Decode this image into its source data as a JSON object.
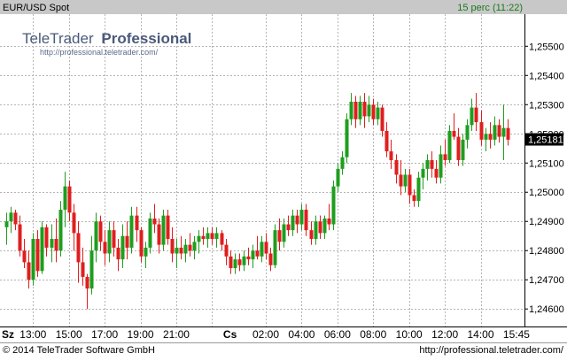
{
  "header": {
    "symbol": "EUR/USD Spot",
    "interval": "15 perc (11:22)"
  },
  "watermark": {
    "brand_light": "TeleTrader",
    "brand_bold": "Professional",
    "url": "http://professional.teletrader.com/"
  },
  "footer": {
    "copyright": "© 2014  TeleTrader Software GmbH",
    "url": "http://professional.teletrader.com/"
  },
  "colors": {
    "header_bg": "#c8c8c8",
    "plot_bg": "#ffffff",
    "grid": "#b4b4b4",
    "up": "#1e9e1e",
    "down": "#e01e1e",
    "last_price_bg": "#000000",
    "last_price_text": "#ffffff",
    "header_right_text": "#1a7a1a"
  },
  "chart_data": {
    "type": "candlestick",
    "y_axis": {
      "min": 1.2454,
      "max": 1.2561,
      "ticks": [
        "1,25500",
        "1,25400",
        "1,25300",
        "1,25200",
        "1,25100",
        "1,25000",
        "1,24900",
        "1,24800",
        "1,24700",
        "1,24600"
      ],
      "tick_values": [
        1.255,
        1.254,
        1.253,
        1.252,
        1.251,
        1.25,
        1.249,
        1.248,
        1.247,
        1.246
      ],
      "position": "right",
      "last_price_label": "1,25181",
      "last_price": 1.25181
    },
    "x_axis": {
      "labels": [
        "Sz",
        "13:00",
        "15:00",
        "17:00",
        "19:00",
        "21:00",
        "Cs",
        "02:00",
        "04:00",
        "06:00",
        "08:00",
        "10:00",
        "12:00",
        "14:00",
        "15:45"
      ],
      "label_slots": [
        0,
        6,
        14,
        22,
        30,
        38,
        50,
        58,
        66,
        74,
        82,
        90,
        98,
        106,
        114
      ],
      "grid_slots": [
        6,
        14,
        22,
        30,
        38,
        46,
        58,
        66,
        74,
        82,
        90,
        98,
        106
      ],
      "slot_count": 116
    },
    "grid": true,
    "candles": [
      {
        "o": 1.2488,
        "h": 1.2493,
        "l": 1.2482,
        "c": 1.249
      },
      {
        "o": 1.249,
        "h": 1.2495,
        "l": 1.2486,
        "c": 1.2493
      },
      {
        "o": 1.2493,
        "h": 1.2494,
        "l": 1.2487,
        "c": 1.2489
      },
      {
        "o": 1.2489,
        "h": 1.2492,
        "l": 1.2478,
        "c": 1.248
      },
      {
        "o": 1.248,
        "h": 1.2484,
        "l": 1.2474,
        "c": 1.2476
      },
      {
        "o": 1.2476,
        "h": 1.248,
        "l": 1.2467,
        "c": 1.247
      },
      {
        "o": 1.247,
        "h": 1.2486,
        "l": 1.2468,
        "c": 1.2484
      },
      {
        "o": 1.2484,
        "h": 1.2487,
        "l": 1.2471,
        "c": 1.2473
      },
      {
        "o": 1.2473,
        "h": 1.249,
        "l": 1.2472,
        "c": 1.2488
      },
      {
        "o": 1.2488,
        "h": 1.2489,
        "l": 1.2478,
        "c": 1.2481
      },
      {
        "o": 1.2481,
        "h": 1.2489,
        "l": 1.2476,
        "c": 1.2484
      },
      {
        "o": 1.2484,
        "h": 1.2491,
        "l": 1.2476,
        "c": 1.248
      },
      {
        "o": 1.248,
        "h": 1.2497,
        "l": 1.2478,
        "c": 1.2494
      },
      {
        "o": 1.2494,
        "h": 1.2507,
        "l": 1.2488,
        "c": 1.2502
      },
      {
        "o": 1.2502,
        "h": 1.2504,
        "l": 1.249,
        "c": 1.2493
      },
      {
        "o": 1.2493,
        "h": 1.2496,
        "l": 1.248,
        "c": 1.2486
      },
      {
        "o": 1.2486,
        "h": 1.249,
        "l": 1.2469,
        "c": 1.2476
      },
      {
        "o": 1.2476,
        "h": 1.2481,
        "l": 1.2468,
        "c": 1.2471
      },
      {
        "o": 1.2471,
        "h": 1.2472,
        "l": 1.246,
        "c": 1.2467
      },
      {
        "o": 1.2467,
        "h": 1.2485,
        "l": 1.2465,
        "c": 1.248
      },
      {
        "o": 1.248,
        "h": 1.2493,
        "l": 1.2476,
        "c": 1.249
      },
      {
        "o": 1.249,
        "h": 1.2492,
        "l": 1.248,
        "c": 1.2483
      },
      {
        "o": 1.2483,
        "h": 1.2487,
        "l": 1.2475,
        "c": 1.2479
      },
      {
        "o": 1.2479,
        "h": 1.249,
        "l": 1.2476,
        "c": 1.2487
      },
      {
        "o": 1.2487,
        "h": 1.249,
        "l": 1.2478,
        "c": 1.2481
      },
      {
        "o": 1.2481,
        "h": 1.2484,
        "l": 1.2473,
        "c": 1.2477
      },
      {
        "o": 1.2477,
        "h": 1.2489,
        "l": 1.2474,
        "c": 1.2485
      },
      {
        "o": 1.2485,
        "h": 1.249,
        "l": 1.2477,
        "c": 1.2481
      },
      {
        "o": 1.2481,
        "h": 1.2495,
        "l": 1.2479,
        "c": 1.2492
      },
      {
        "o": 1.2492,
        "h": 1.2495,
        "l": 1.2483,
        "c": 1.2487
      },
      {
        "o": 1.2487,
        "h": 1.2488,
        "l": 1.2476,
        "c": 1.2478
      },
      {
        "o": 1.2478,
        "h": 1.2483,
        "l": 1.2474,
        "c": 1.2481
      },
      {
        "o": 1.2481,
        "h": 1.2493,
        "l": 1.2479,
        "c": 1.2491
      },
      {
        "o": 1.2491,
        "h": 1.2496,
        "l": 1.2486,
        "c": 1.2489
      },
      {
        "o": 1.2489,
        "h": 1.2491,
        "l": 1.2479,
        "c": 1.2482
      },
      {
        "o": 1.2482,
        "h": 1.2494,
        "l": 1.248,
        "c": 1.2492
      },
      {
        "o": 1.2492,
        "h": 1.2494,
        "l": 1.2482,
        "c": 1.2484
      },
      {
        "o": 1.2484,
        "h": 1.2488,
        "l": 1.2476,
        "c": 1.2479
      },
      {
        "o": 1.2479,
        "h": 1.2484,
        "l": 1.2474,
        "c": 1.2481
      },
      {
        "o": 1.2481,
        "h": 1.2485,
        "l": 1.2477,
        "c": 1.2479
      },
      {
        "o": 1.2479,
        "h": 1.2484,
        "l": 1.2476,
        "c": 1.2482
      },
      {
        "o": 1.2482,
        "h": 1.2486,
        "l": 1.2478,
        "c": 1.248
      },
      {
        "o": 1.248,
        "h": 1.2485,
        "l": 1.2477,
        "c": 1.2483
      },
      {
        "o": 1.2483,
        "h": 1.2487,
        "l": 1.2479,
        "c": 1.2485
      },
      {
        "o": 1.2485,
        "h": 1.2488,
        "l": 1.2482,
        "c": 1.2484
      },
      {
        "o": 1.2484,
        "h": 1.2488,
        "l": 1.2481,
        "c": 1.2486
      },
      {
        "o": 1.2486,
        "h": 1.2488,
        "l": 1.2482,
        "c": 1.2484
      },
      {
        "o": 1.2484,
        "h": 1.2488,
        "l": 1.2481,
        "c": 1.2486
      },
      {
        "o": 1.2486,
        "h": 1.2487,
        "l": 1.248,
        "c": 1.2482
      },
      {
        "o": 1.2482,
        "h": 1.2484,
        "l": 1.2475,
        "c": 1.2478
      },
      {
        "o": 1.2478,
        "h": 1.248,
        "l": 1.2472,
        "c": 1.2474
      },
      {
        "o": 1.2474,
        "h": 1.2479,
        "l": 1.2472,
        "c": 1.2477
      },
      {
        "o": 1.2477,
        "h": 1.2479,
        "l": 1.2473,
        "c": 1.2475
      },
      {
        "o": 1.2475,
        "h": 1.248,
        "l": 1.2473,
        "c": 1.2478
      },
      {
        "o": 1.2478,
        "h": 1.2481,
        "l": 1.2475,
        "c": 1.2477
      },
      {
        "o": 1.2477,
        "h": 1.2482,
        "l": 1.2474,
        "c": 1.248
      },
      {
        "o": 1.248,
        "h": 1.2485,
        "l": 1.2477,
        "c": 1.2478
      },
      {
        "o": 1.2478,
        "h": 1.2485,
        "l": 1.2476,
        "c": 1.2483
      },
      {
        "o": 1.2483,
        "h": 1.2486,
        "l": 1.2477,
        "c": 1.2479
      },
      {
        "o": 1.2479,
        "h": 1.2481,
        "l": 1.2473,
        "c": 1.2475
      },
      {
        "o": 1.2475,
        "h": 1.2489,
        "l": 1.2474,
        "c": 1.2487
      },
      {
        "o": 1.2487,
        "h": 1.2491,
        "l": 1.248,
        "c": 1.2483
      },
      {
        "o": 1.2483,
        "h": 1.2491,
        "l": 1.2481,
        "c": 1.2489
      },
      {
        "o": 1.2489,
        "h": 1.2492,
        "l": 1.2485,
        "c": 1.2487
      },
      {
        "o": 1.2487,
        "h": 1.2494,
        "l": 1.2485,
        "c": 1.2492
      },
      {
        "o": 1.2492,
        "h": 1.2494,
        "l": 1.2486,
        "c": 1.2489
      },
      {
        "o": 1.2489,
        "h": 1.2496,
        "l": 1.2487,
        "c": 1.2494
      },
      {
        "o": 1.2494,
        "h": 1.2496,
        "l": 1.2485,
        "c": 1.2487
      },
      {
        "o": 1.2487,
        "h": 1.249,
        "l": 1.2482,
        "c": 1.2484
      },
      {
        "o": 1.2484,
        "h": 1.2492,
        "l": 1.2482,
        "c": 1.249
      },
      {
        "o": 1.249,
        "h": 1.2492,
        "l": 1.2484,
        "c": 1.2486
      },
      {
        "o": 1.2486,
        "h": 1.2492,
        "l": 1.2484,
        "c": 1.2491
      },
      {
        "o": 1.2491,
        "h": 1.2496,
        "l": 1.2487,
        "c": 1.2489
      },
      {
        "o": 1.2489,
        "h": 1.2504,
        "l": 1.2487,
        "c": 1.2502
      },
      {
        "o": 1.2502,
        "h": 1.251,
        "l": 1.25,
        "c": 1.2508
      },
      {
        "o": 1.2508,
        "h": 1.2514,
        "l": 1.2506,
        "c": 1.2512
      },
      {
        "o": 1.2512,
        "h": 1.2527,
        "l": 1.251,
        "c": 1.2525
      },
      {
        "o": 1.2525,
        "h": 1.2534,
        "l": 1.2523,
        "c": 1.2531
      },
      {
        "o": 1.2531,
        "h": 1.2533,
        "l": 1.2522,
        "c": 1.2525
      },
      {
        "o": 1.2525,
        "h": 1.2533,
        "l": 1.2523,
        "c": 1.2531
      },
      {
        "o": 1.2531,
        "h": 1.2534,
        "l": 1.2522,
        "c": 1.2526
      },
      {
        "o": 1.2526,
        "h": 1.2533,
        "l": 1.2524,
        "c": 1.253
      },
      {
        "o": 1.253,
        "h": 1.2532,
        "l": 1.2523,
        "c": 1.2525
      },
      {
        "o": 1.2525,
        "h": 1.2531,
        "l": 1.2523,
        "c": 1.2529
      },
      {
        "o": 1.2529,
        "h": 1.253,
        "l": 1.2519,
        "c": 1.2521
      },
      {
        "o": 1.2521,
        "h": 1.2524,
        "l": 1.2512,
        "c": 1.2514
      },
      {
        "o": 1.2514,
        "h": 1.2518,
        "l": 1.2508,
        "c": 1.2511
      },
      {
        "o": 1.2511,
        "h": 1.2513,
        "l": 1.2503,
        "c": 1.2506
      },
      {
        "o": 1.2506,
        "h": 1.2511,
        "l": 1.2499,
        "c": 1.2502
      },
      {
        "o": 1.2502,
        "h": 1.2508,
        "l": 1.25,
        "c": 1.2506
      },
      {
        "o": 1.2506,
        "h": 1.2508,
        "l": 1.2496,
        "c": 1.2499
      },
      {
        "o": 1.2499,
        "h": 1.2501,
        "l": 1.2495,
        "c": 1.2497
      },
      {
        "o": 1.2497,
        "h": 1.2507,
        "l": 1.2495,
        "c": 1.2505
      },
      {
        "o": 1.2505,
        "h": 1.251,
        "l": 1.2501,
        "c": 1.2508
      },
      {
        "o": 1.2508,
        "h": 1.2513,
        "l": 1.2504,
        "c": 1.2511
      },
      {
        "o": 1.2511,
        "h": 1.2514,
        "l": 1.2505,
        "c": 1.2508
      },
      {
        "o": 1.2508,
        "h": 1.2511,
        "l": 1.2503,
        "c": 1.2505
      },
      {
        "o": 1.2505,
        "h": 1.2516,
        "l": 1.2503,
        "c": 1.2513
      },
      {
        "o": 1.2513,
        "h": 1.2518,
        "l": 1.2509,
        "c": 1.2511
      },
      {
        "o": 1.2511,
        "h": 1.2523,
        "l": 1.251,
        "c": 1.2521
      },
      {
        "o": 1.2521,
        "h": 1.2527,
        "l": 1.2518,
        "c": 1.2519
      },
      {
        "o": 1.2519,
        "h": 1.2522,
        "l": 1.2509,
        "c": 1.2511
      },
      {
        "o": 1.2511,
        "h": 1.252,
        "l": 1.2509,
        "c": 1.2518
      },
      {
        "o": 1.2518,
        "h": 1.2525,
        "l": 1.2515,
        "c": 1.2523
      },
      {
        "o": 1.2523,
        "h": 1.2532,
        "l": 1.2521,
        "c": 1.2529
      },
      {
        "o": 1.2529,
        "h": 1.2534,
        "l": 1.2521,
        "c": 1.2524
      },
      {
        "o": 1.2524,
        "h": 1.2528,
        "l": 1.2516,
        "c": 1.2518
      },
      {
        "o": 1.2518,
        "h": 1.2522,
        "l": 1.2514,
        "c": 1.252
      },
      {
        "o": 1.252,
        "h": 1.2524,
        "l": 1.2515,
        "c": 1.2518
      },
      {
        "o": 1.2518,
        "h": 1.2526,
        "l": 1.2516,
        "c": 1.2523
      },
      {
        "o": 1.2523,
        "h": 1.2525,
        "l": 1.2517,
        "c": 1.2519
      },
      {
        "o": 1.2519,
        "h": 1.253,
        "l": 1.2511,
        "c": 1.2522
      },
      {
        "o": 1.2522,
        "h": 1.2525,
        "l": 1.2516,
        "c": 1.2518
      }
    ]
  }
}
